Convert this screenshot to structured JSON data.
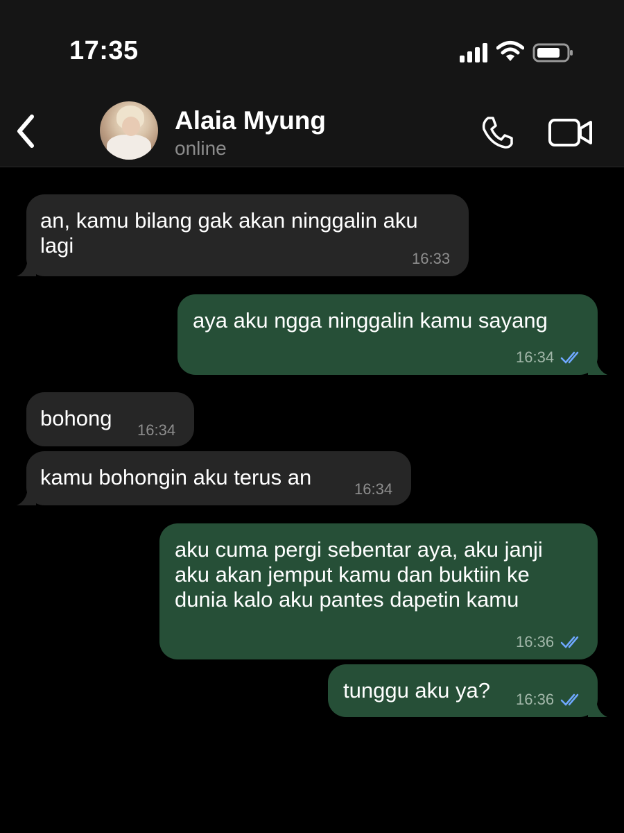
{
  "status_bar": {
    "time": "17:35"
  },
  "header": {
    "contact_name": "Alaia Myung",
    "contact_status": "online",
    "icons": [
      "back-icon",
      "phone-icon",
      "video-camera-icon"
    ]
  },
  "colors": {
    "incoming_bubble": "#262626",
    "outgoing_bubble": "#264f37",
    "read_ticks": "#6fa8ff"
  },
  "messages": [
    {
      "direction": "incoming",
      "text": "an, kamu bilang gak akan ninggalin aku\nlagi",
      "time": "16:33"
    },
    {
      "direction": "outgoing",
      "text": "aya aku ngga ninggalin kamu sayang",
      "time": "16:34",
      "status": "read"
    },
    {
      "direction": "incoming",
      "text": "bohong",
      "time": "16:34"
    },
    {
      "direction": "incoming",
      "text": "kamu bohongin aku terus an",
      "time": "16:34"
    },
    {
      "direction": "outgoing",
      "text": "aku cuma pergi sebentar aya, aku janji\naku akan jemput kamu dan buktiin ke\ndunia kalo aku pantes dapetin kamu",
      "time": "16:36",
      "status": "read"
    },
    {
      "direction": "outgoing",
      "text": "tunggu aku ya?",
      "time": "16:36",
      "status": "read"
    }
  ]
}
